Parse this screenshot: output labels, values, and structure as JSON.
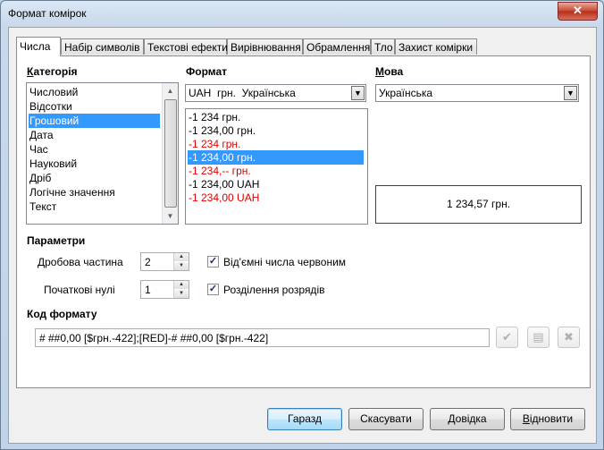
{
  "window": {
    "title": "Формат комірок",
    "close_glyph": "✕"
  },
  "tabs": [
    "Числа",
    "Набір символів",
    "Текстові ефекти",
    "Вирівнювання",
    "Обрамлення",
    "Тло",
    "Захист комірки"
  ],
  "category": {
    "label": "Категорія",
    "items": [
      "Числовий",
      "Відсотки",
      "Грошовий",
      "Дата",
      "Час",
      "Науковий",
      "Дріб",
      "Логічне значення",
      "Текст"
    ],
    "selected_index": 2
  },
  "format": {
    "label": "Формат",
    "currency_value": "UAH  грн.  Українська",
    "items": [
      {
        "text": "-1 234 грн.",
        "red": false
      },
      {
        "text": "-1 234,00 грн.",
        "red": false
      },
      {
        "text": "-1 234 грн.",
        "red": true
      },
      {
        "text": "-1 234,00 грн.",
        "red": true
      },
      {
        "text": "-1 234,-- грн.",
        "red": true
      },
      {
        "text": "-1 234,00 UAH",
        "red": false
      },
      {
        "text": "-1 234,00 UAH",
        "red": true
      }
    ],
    "selected_index": 3
  },
  "language": {
    "label": "Мова",
    "value": "Українська"
  },
  "preview": {
    "value": "1 234,57 грн."
  },
  "options": {
    "label": "Параметри",
    "decimal_label": "Дробова частина",
    "decimal_value": "2",
    "leading_zeros_label": "Початкові нулі",
    "leading_zeros_value": "1",
    "negative_red_label": "Від'ємні числа червоним",
    "negative_red_checked": true,
    "thousands_label": "Розділення розрядів",
    "thousands_checked": true
  },
  "format_code": {
    "label": "Код формату",
    "value": "# ##0,00 [$грн.-422];[RED]-# ##0,00 [$грн.-422]"
  },
  "buttons": {
    "ok": "Гаразд",
    "cancel": "Скасувати",
    "help": "Довідка",
    "reset": "Відновити"
  },
  "colors": {
    "selection": "#3399ff",
    "negative_red": "#e00000"
  }
}
